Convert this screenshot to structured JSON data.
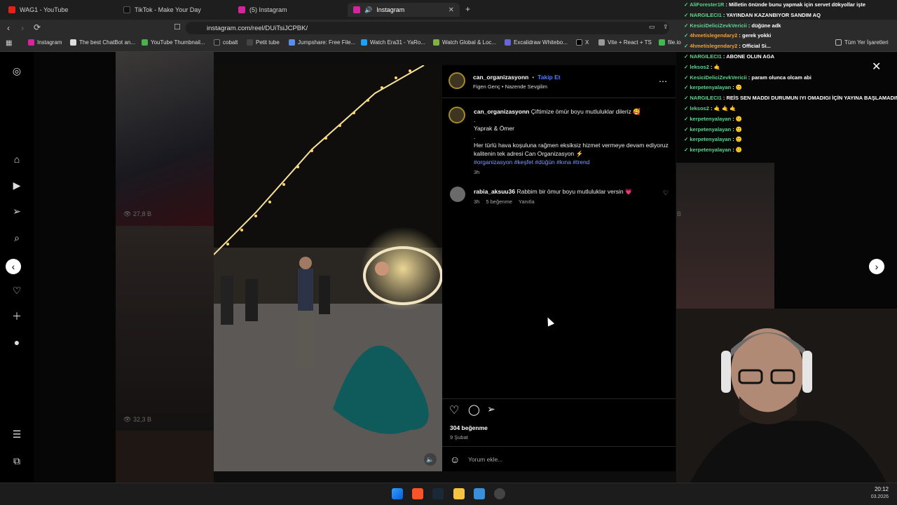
{
  "tabs": [
    {
      "label": "WAG1 - YouTube",
      "color": "#e62117"
    },
    {
      "label": "TikTok - Make Your Day",
      "color": "#111111"
    },
    {
      "label": "(5) Instagram",
      "color": "#d6249f"
    },
    {
      "label": "Instagram",
      "color": "#d6249f"
    }
  ],
  "address": {
    "url": "instagram.com/reel/DUiTsiJCPBK/"
  },
  "bookmarks": [
    "Instagram",
    "The best ChatBot an...",
    "YouTube Thumbnail...",
    "cobalt",
    "Petit tube",
    "Jumpshare: Free File...",
    "Watch Era31 - YaRo...",
    "Watch Global & Loc...",
    "Excalidraw Whitebo...",
    "X",
    "Vite + React + TS",
    "file.io",
    "Tüm Yer İşaretleri"
  ],
  "grid": {
    "views_left_top": "27,8 B",
    "views_left_bottom": "32,3 B",
    "views_right": "B"
  },
  "post": {
    "username": "can_organizasyonn",
    "follow_label": "Takip Et",
    "audio": "Figen Genç • Nazende Sevgilim",
    "caption_user": "can_organizasyonn",
    "caption_first": "Çiftimize ömür boyu mutluluklar dileriz 🥰",
    "caption_dot": ".",
    "caption_names": "Yaprak & Ömer",
    "caption_dot2": ".",
    "caption_body": "Her türlü hava koşuluna rağmen eksiksiz hizmet vermeye devam ediyoruz kalitenin tek adresi Can Organizasyon ⚡",
    "hashtags": "#organizasyon #keşfet #düğün #kına #trend",
    "caption_time": "3h",
    "comment_user": "rabia_aksuu36",
    "comment_text": "Rabbim bir ömur boyu mutluluklar versin 💗",
    "comment_time": "3h",
    "comment_likes": "5 beğenme",
    "comment_reply": "Yanıtla",
    "likes": "304 beğenme",
    "date": "9 Şubat",
    "comment_placeholder": "Yorum ekle..."
  },
  "chat": [
    {
      "user": "AliForester1R",
      "msg": "Milletin önünde bunu yapmak için servet dökyollar işte",
      "color": "green"
    },
    {
      "user": "NARGILECI1",
      "msg": "YAYINDAN KAZANBIYOR SANDIM AQ",
      "color": "green"
    },
    {
      "user": "KesiciDeliciZevkVericii",
      "msg": "düğüne adk",
      "color": "green"
    },
    {
      "user": "4hmetislegendary2",
      "msg": "gerek yokki",
      "color": "orange"
    },
    {
      "user": "4hmetislegendary2",
      "msg": "Official Si...",
      "color": "orange"
    },
    {
      "user": "NARGILECI1",
      "msg": "ABONE OLUN AGA",
      "color": "green"
    },
    {
      "user": "leksos2",
      "msg": "🤙",
      "color": "green"
    },
    {
      "user": "KesiciDeliciZevkVericii",
      "msg": "param olunca olcam abi",
      "color": "green"
    },
    {
      "user": "kerpetenyalayan",
      "msg": "🙂",
      "color": "green"
    },
    {
      "user": "NARGILECI1",
      "msg": "REİS SEN MADDI DURUMUN IYI OMADIGI İÇİN YAYINA BAŞLAMADINMI",
      "color": "green"
    },
    {
      "user": "leksos2",
      "msg": "🤙 🤙 🤙",
      "color": "green"
    },
    {
      "user": "kerpetenyalayan",
      "msg": "🙂",
      "color": "green"
    },
    {
      "user": "kerpetenyalayan",
      "msg": "🙂",
      "color": "green"
    },
    {
      "user": "kerpetenyalayan",
      "msg": "🙂",
      "color": "green"
    },
    {
      "user": "kerpetenyalayan",
      "msg": "🙂",
      "color": "green"
    }
  ],
  "clock": {
    "time": "20:12",
    "date": "03.2026"
  }
}
